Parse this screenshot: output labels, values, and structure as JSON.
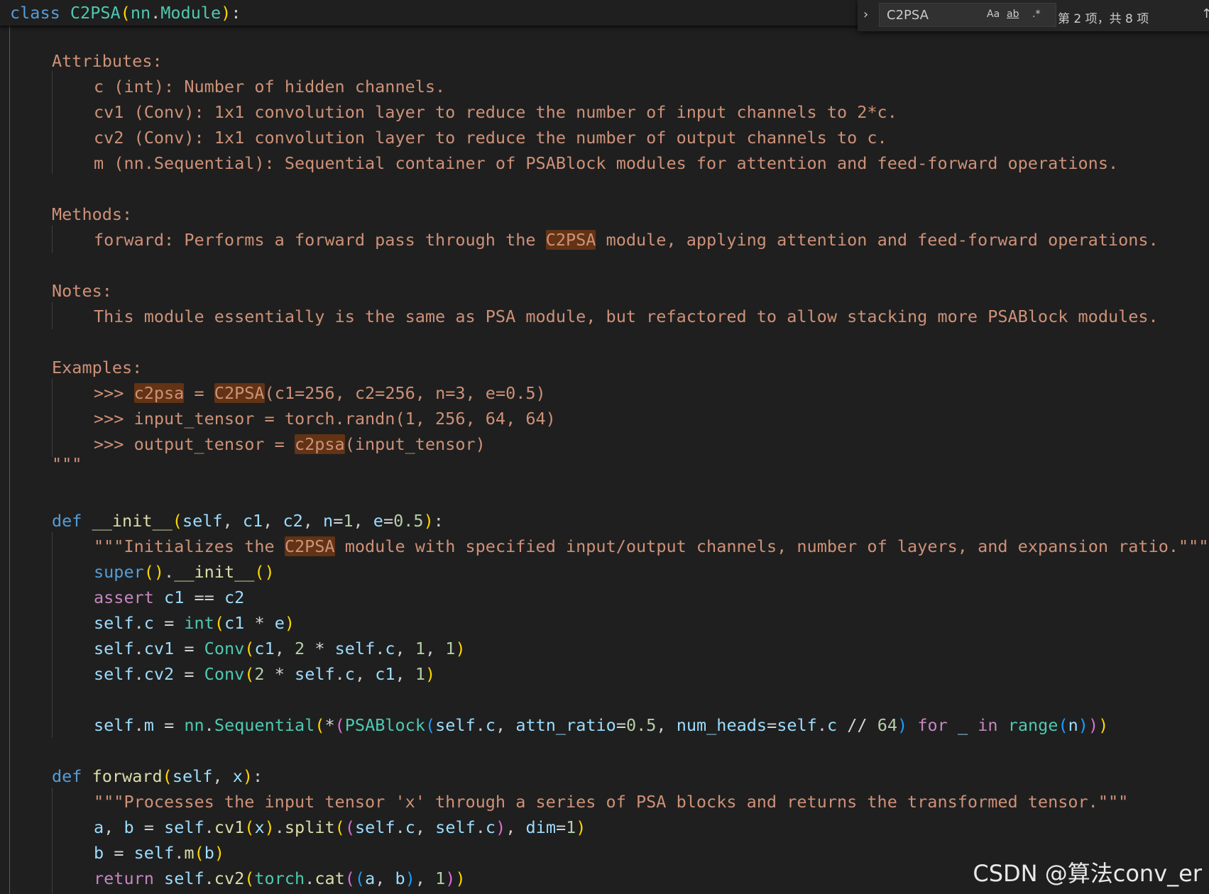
{
  "sticky_header": {
    "class_keyword": "class",
    "class_name": "C2PSA",
    "base_module": "nn",
    "base_class": "Module"
  },
  "find_widget": {
    "query": "C2PSA",
    "match_case": "Aa",
    "whole_word": "ab",
    "regex": ".*",
    "result_count": "第 2 项，共 8 项",
    "toggle_icon": "chevron-right-icon",
    "prev_icon": "arrow-up-icon"
  },
  "docstring": {
    "attributes_heading": "Attributes:",
    "attributes": [
      "c (int): Number of hidden channels.",
      "cv1 (Conv): 1x1 convolution layer to reduce the number of input channels to 2*c.",
      "cv2 (Conv): 1x1 convolution layer to reduce the number of output channels to c.",
      "m (nn.Sequential): Sequential container of PSABlock modules for attention and feed-forward operations."
    ],
    "methods_heading": "Methods:",
    "method_pre": "forward: Performs a forward pass through the ",
    "method_match": "C2PSA",
    "method_post": " module, applying attention and feed-forward operations.",
    "notes_heading": "Notes:",
    "note": "This module essentially is the same as PSA module, but refactored to allow stacking more PSABlock modules.",
    "examples_heading": "Examples:",
    "ex1_prompt": ">>> ",
    "ex1_var": "c2psa",
    "ex1_eq": " = ",
    "ex1_cls": "C2PSA",
    "ex1_args": "(c1=256, c2=256, n=3, e=0.5)",
    "ex2": ">>> input_tensor = torch.randn(1, 256, 64, 64)",
    "ex3_pre": ">>> output_tensor = ",
    "ex3_var": "c2psa",
    "ex3_post": "(input_tensor)",
    "close": "\"\"\""
  },
  "init_method": {
    "def": "def",
    "name": "__init__",
    "self": "self",
    "c1": "c1",
    "c2": "c2",
    "n": "n",
    "n_default": "1",
    "e": "e",
    "e_default": "0.5",
    "doc_pre": "\"\"\"Initializes the ",
    "doc_match": "C2PSA",
    "doc_post": " module with specified input/output channels, number of layers, and expansion ratio.\"\"\"",
    "super_call": "super",
    "super_init": "__init__",
    "assert_kw": "assert",
    "int_fn": "int",
    "conv_fn": "Conv",
    "num_1": "1",
    "num_2": "2",
    "nn": "nn",
    "sequential": "Sequential",
    "psablock": "PSABlock",
    "attn_ratio": "attn_ratio",
    "attn_val": "0.5",
    "num_heads": "num_heads",
    "num_64": "64",
    "for_kw": "for",
    "in_kw": "in",
    "underscore": "_",
    "range_fn": "range"
  },
  "forward_method": {
    "def": "def",
    "name": "forward",
    "x": "x",
    "doc": "\"\"\"Processes the input tensor 'x' through a series of PSA blocks and returns the transformed tensor.\"\"\"",
    "a": "a",
    "b": "b",
    "cv1": "cv1",
    "cv2": "cv2",
    "split": "split",
    "dim": "dim",
    "m": "m",
    "return_kw": "return",
    "torch": "torch",
    "cat": "cat"
  },
  "watermark": "CSDN @算法conv_er"
}
